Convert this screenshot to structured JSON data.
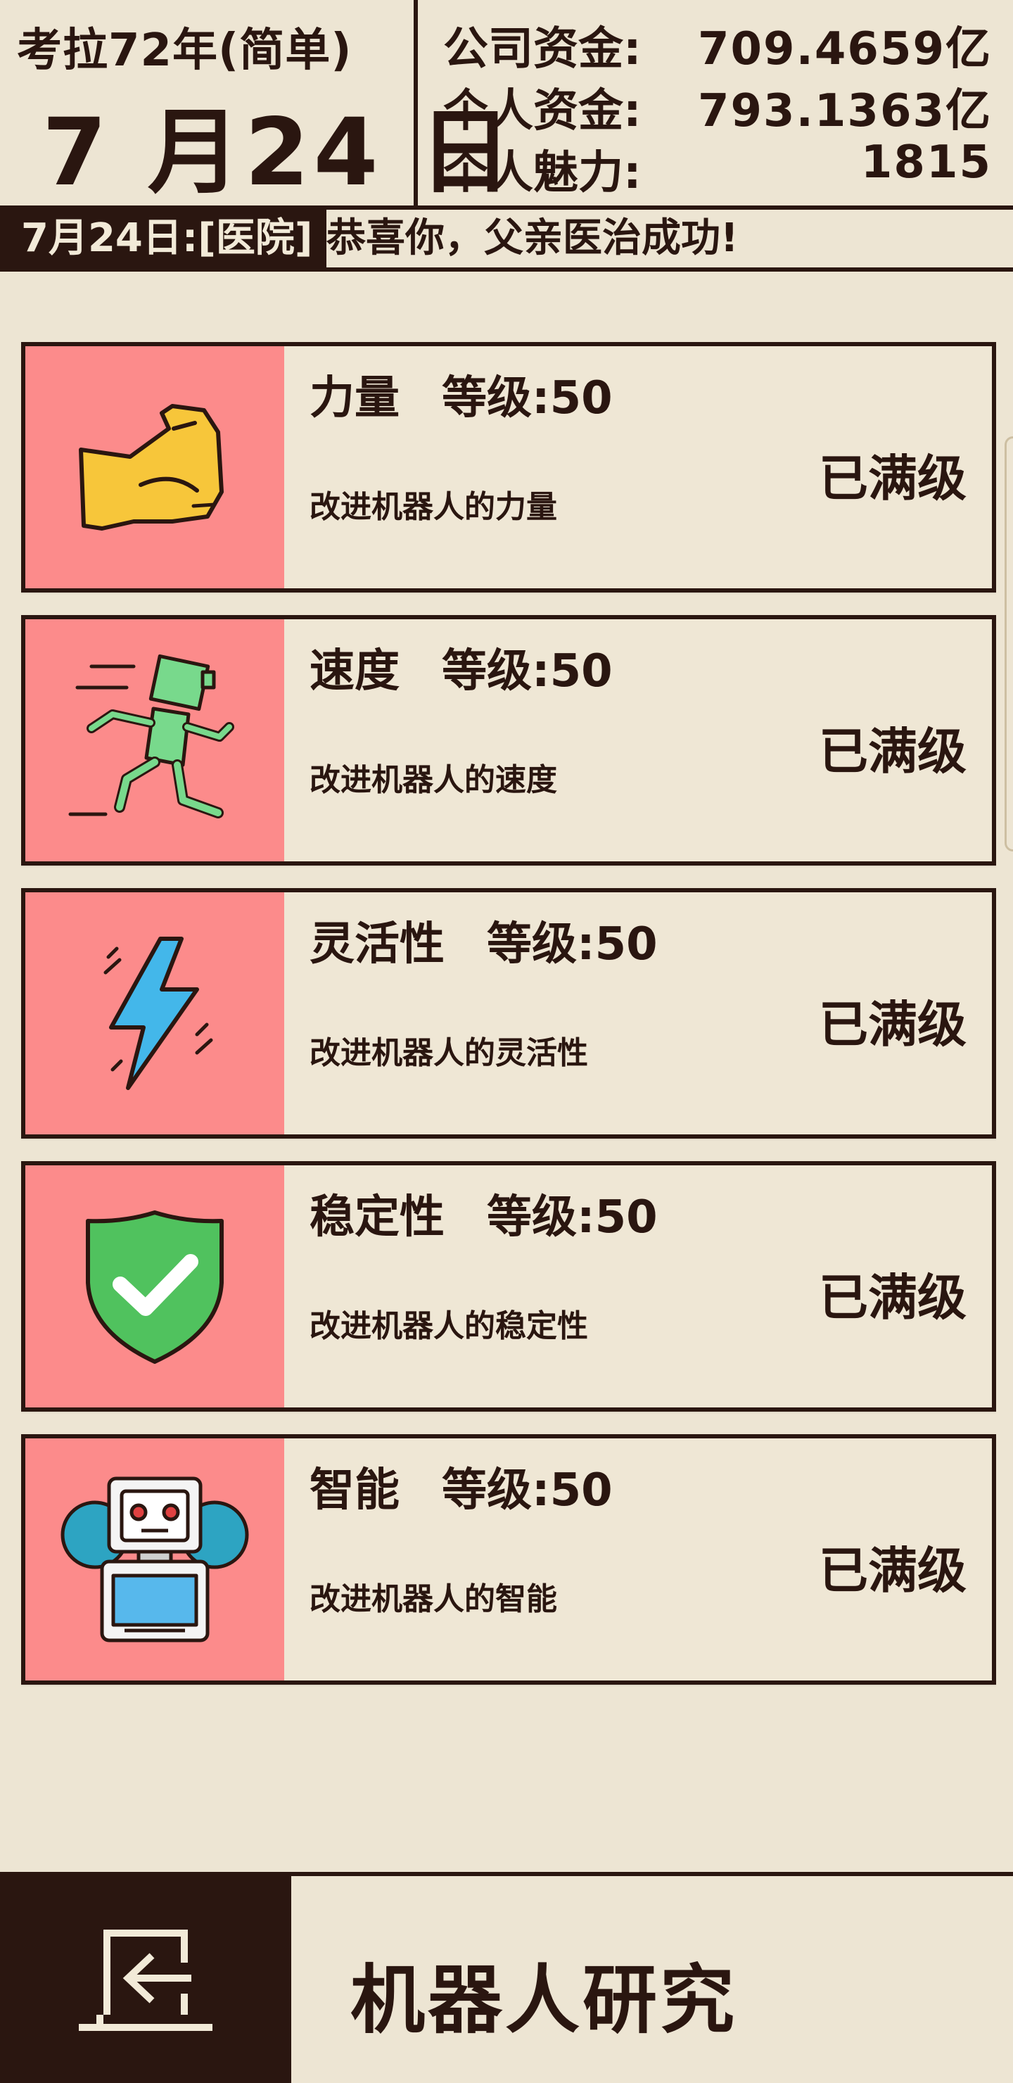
{
  "header": {
    "year_label": "考拉72年(简单)",
    "date_label": "7 月24 日",
    "stats": [
      {
        "label": "公司资金:",
        "value": "709.4659亿"
      },
      {
        "label": "个人资金:",
        "value": "793.1363亿"
      },
      {
        "label": "个人魅力:",
        "value": "1815"
      }
    ]
  },
  "news": {
    "prefix": "7月24日:[医院]",
    "text": "恭喜你，父亲医治成功!"
  },
  "upgrades": [
    {
      "name": "力量",
      "level": "等级:50",
      "desc": "改进机器人的力量",
      "status": "已满级",
      "icon": "muscle-arm-icon"
    },
    {
      "name": "速度",
      "level": "等级:50",
      "desc": "改进机器人的速度",
      "status": "已满级",
      "icon": "running-robot-icon"
    },
    {
      "name": "灵活性",
      "level": "等级:50",
      "desc": "改进机器人的灵活性",
      "status": "已满级",
      "icon": "lightning-bolt-icon"
    },
    {
      "name": "稳定性",
      "level": "等级:50",
      "desc": "改进机器人的稳定性",
      "status": "已满级",
      "icon": "shield-check-icon"
    },
    {
      "name": "智能",
      "level": "等级:50",
      "desc": "改进机器人的智能",
      "status": "已满级",
      "icon": "robot-gear-icon"
    }
  ],
  "footer": {
    "title": "机器人研究",
    "back_icon": "exit-door-icon"
  },
  "colors": {
    "background": "#ede5d3",
    "dark": "#2a1610",
    "icon_panel": "#fc8b8b"
  }
}
